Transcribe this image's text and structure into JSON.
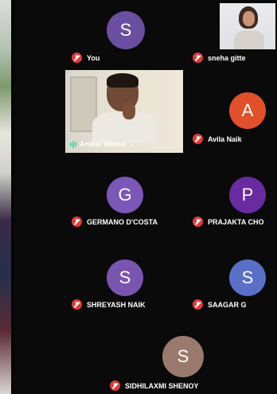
{
  "participants": [
    {
      "id": "you",
      "name": "You",
      "initial": "S",
      "color": "#6b4ea0",
      "muted": true,
      "type": "avatar"
    },
    {
      "id": "sneha",
      "name": "sneha gitte",
      "muted": true,
      "type": "video"
    },
    {
      "id": "aniket",
      "name": "Aniket Wanve",
      "muted": false,
      "type": "video"
    },
    {
      "id": "avila",
      "name": "Avila Naik",
      "initial": "A",
      "color": "#e0502a",
      "muted": true,
      "type": "avatar"
    },
    {
      "id": "germano",
      "name": "GERMANO D'COSTA",
      "initial": "G",
      "color": "#7b57b8",
      "muted": true,
      "type": "avatar"
    },
    {
      "id": "prajakta",
      "name": "PRAJAKTA CHO",
      "initial": "P",
      "color": "#6a2aa0",
      "muted": true,
      "type": "avatar"
    },
    {
      "id": "shreyash",
      "name": "SHREYASH NAIK",
      "initial": "S",
      "color": "#7a55b0",
      "muted": true,
      "type": "avatar"
    },
    {
      "id": "saagar",
      "name": "SAAGAR G",
      "initial": "S",
      "color": "#5a6fc8",
      "muted": true,
      "type": "avatar"
    },
    {
      "id": "sidhilaxmi",
      "name": "SIDHILAXMI SHENOY",
      "initial": "S",
      "color": "#9a7a6c",
      "muted": true,
      "type": "avatar"
    }
  ],
  "icons": {
    "muted": "mic-off-icon",
    "speaking": "audio-level-icon",
    "more": "chevron-down-icon"
  }
}
